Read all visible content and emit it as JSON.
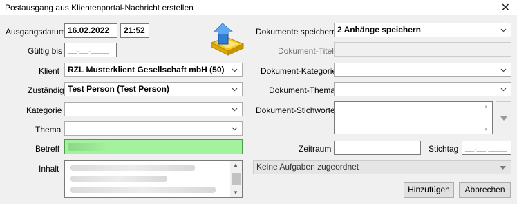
{
  "window": {
    "title": "Postausgang aus Klientenportal-Nachricht erstellen",
    "close_glyph": "✕"
  },
  "left": {
    "ausgangsdatum": {
      "label": "Ausgangsdatum",
      "date": "16.02.2022",
      "time": "21:52"
    },
    "gueltig_bis": {
      "label": "Gültig bis",
      "value": "__.__.____"
    },
    "klient": {
      "label": "Klient",
      "value": "RZL Musterklient Gesellschaft mbH (50)"
    },
    "zustaendig": {
      "label": "Zuständig",
      "value": "Test Person (Test Person)"
    },
    "kategorie": {
      "label": "Kategorie",
      "value": ""
    },
    "thema": {
      "label": "Thema",
      "value": ""
    },
    "betreff": {
      "label": "Betreff",
      "value": ""
    },
    "inhalt": {
      "label": "Inhalt",
      "value": ""
    }
  },
  "right": {
    "dokumente_speichern": {
      "label": "Dokumente speichern",
      "value": "2 Anhänge speichern"
    },
    "dokument_titel": {
      "label": "Dokument-Titel",
      "value": ""
    },
    "dokument_kategorie": {
      "label": "Dokument-Kategorie",
      "value": ""
    },
    "dokument_thema": {
      "label": "Dokument-Thema",
      "value": ""
    },
    "dokument_stichworte": {
      "label": "Dokument-Stichworte",
      "value": ""
    },
    "zeitraum": {
      "label": "Zeitraum",
      "value": ""
    },
    "stichtag": {
      "label": "Stichtag",
      "value": "__.__.____"
    },
    "aufgaben": {
      "value": "Keine Aufgaben zugeordnet"
    }
  },
  "buttons": {
    "add": "Hinzufügen",
    "cancel": "Abbrechen"
  },
  "icons": {
    "upload": "upload-tray-icon"
  },
  "colors": {
    "betreff_bg": "#a3f29e",
    "accent_blue": "#2f7fd9",
    "tray_yellow": "#f5c518"
  }
}
